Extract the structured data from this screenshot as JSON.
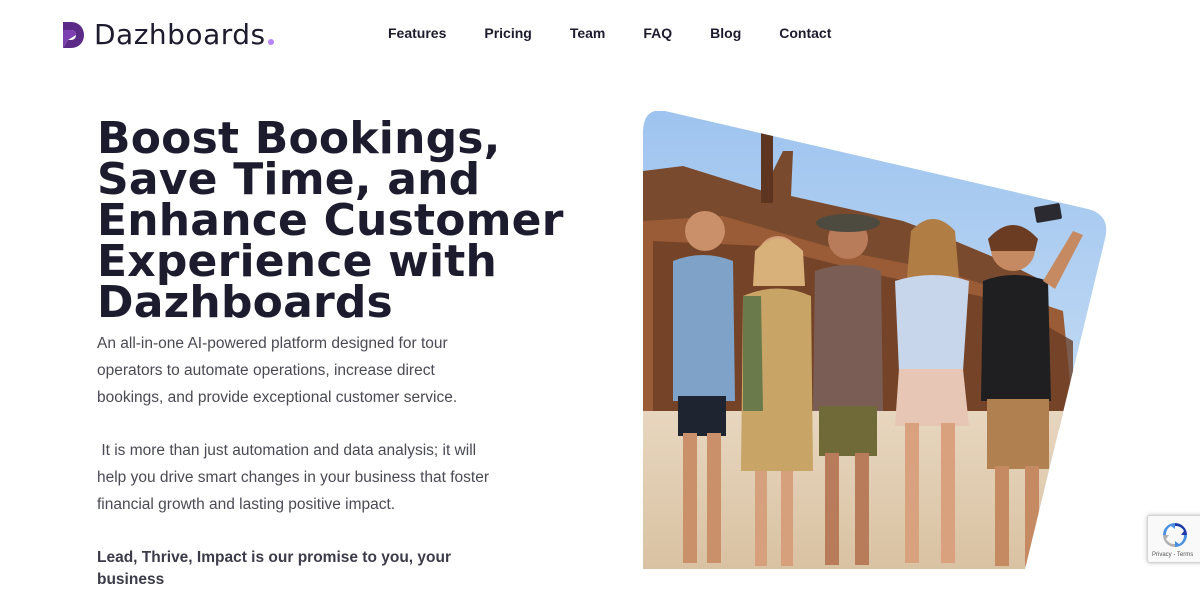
{
  "brand": {
    "name": "Dazhboards",
    "logo_icon": "dazhboards-logo-icon",
    "accent_color": "#5b2a86",
    "dot_color": "#b785f5"
  },
  "nav": {
    "items": [
      {
        "label": "Features"
      },
      {
        "label": "Pricing"
      },
      {
        "label": "Team"
      },
      {
        "label": "FAQ"
      },
      {
        "label": "Blog"
      },
      {
        "label": "Contact"
      }
    ]
  },
  "hero": {
    "title": "Boost Bookings, Save Time, and Enhance Customer Experience with Dazhboards",
    "paragraph1": "An all-in-one AI-powered platform designed for tour operators to automate operations, increase direct bookings, and provide exceptional customer service.",
    "paragraph2": " It is more than just automation and data analysis; it will help you drive smart changes in your business that foster financial growth and lasting positive impact.",
    "promise": "Lead, Thrive, Impact is our promise to you, your business",
    "image_icon": "group-of-travelers-photo"
  },
  "recaptcha": {
    "label": "Privacy - Terms",
    "icon": "recaptcha-icon"
  }
}
